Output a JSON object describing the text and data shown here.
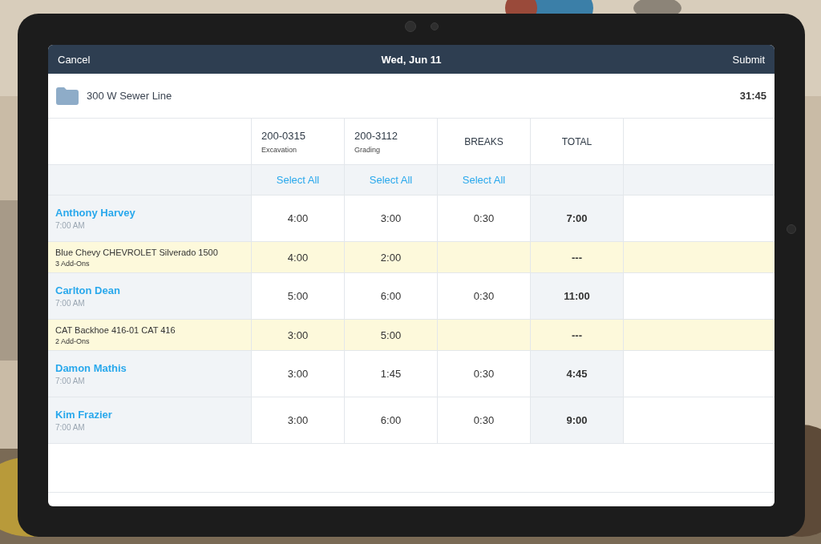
{
  "nav_bar": {
    "left_button": "Cancel",
    "title": "Wed, Jun 11",
    "right_button": "Submit"
  },
  "project": {
    "name": "300 W Sewer Line",
    "total": "31:45"
  },
  "columns": [
    {
      "kind": "code",
      "code": "200-0315",
      "subtitle": "Excavation",
      "select_all": "Select All"
    },
    {
      "kind": "code",
      "code": "200-3112",
      "subtitle": "Grading",
      "select_all": "Select All"
    },
    {
      "kind": "label",
      "label": "BREAKS",
      "select_all": "Select All"
    },
    {
      "kind": "label",
      "label": "TOTAL"
    }
  ],
  "rows": [
    {
      "kind": "person",
      "name": "Anthony Harvey",
      "detail": "7:00 AM",
      "cells": [
        "4:00",
        "3:00",
        "0:30",
        "7:00"
      ]
    },
    {
      "kind": "equipment",
      "name": "Blue Chevy CHEVROLET Silverado 1500",
      "detail": "3 Add-Ons",
      "cells": [
        "4:00",
        "2:00",
        null,
        "---"
      ]
    },
    {
      "kind": "person",
      "name": "Carlton Dean",
      "detail": "7:00 AM",
      "cells": [
        "5:00",
        "6:00",
        "0:30",
        "11:00"
      ]
    },
    {
      "kind": "equipment",
      "name": "CAT Backhoe 416-01 CAT 416",
      "detail": "2 Add-Ons",
      "cells": [
        "3:00",
        "5:00",
        null,
        "---"
      ]
    },
    {
      "kind": "person",
      "name": "Damon Mathis",
      "detail": "7:00 AM",
      "cells": [
        "3:00",
        "1:45",
        "0:30",
        "4:45"
      ]
    },
    {
      "kind": "person",
      "name": "Kim Frazier",
      "detail": "7:00 AM",
      "cells": [
        "3:00",
        "6:00",
        "0:30",
        "9:00"
      ]
    }
  ]
}
